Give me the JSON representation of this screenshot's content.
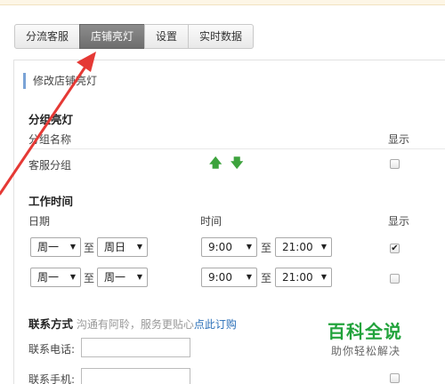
{
  "tabs": [
    {
      "label": "分流客服",
      "active": false
    },
    {
      "label": "店铺亮灯",
      "active": true
    },
    {
      "label": "设置",
      "active": false
    },
    {
      "label": "实时数据",
      "active": false
    }
  ],
  "panel": {
    "title": "修改店铺亮灯",
    "group_section": {
      "title": "分组亮灯",
      "col_name": "分组名称",
      "col_show": "显示",
      "rows": [
        {
          "name": "客服分组",
          "up_icon": "arrow-up-icon",
          "down_icon": "arrow-down-icon",
          "checked": false
        }
      ]
    },
    "work_section": {
      "title": "工作时间",
      "col_date": "日期",
      "col_time": "时间",
      "col_show": "显示",
      "to_label": "至",
      "rows": [
        {
          "day_from": "周一",
          "day_to": "周日",
          "time_from": "9:00",
          "time_to": "21:00",
          "checked": true
        },
        {
          "day_from": "周一",
          "day_to": "周一",
          "time_from": "9:00",
          "time_to": "21:00",
          "checked": false
        }
      ]
    },
    "contact_section": {
      "title": "联系方式",
      "hint": "沟通有阿聆，服务更贴心",
      "link": "点此订购",
      "phone_label": "联系电话:",
      "phone_value": "",
      "mobile_label": "联系手机:",
      "mobile_value": ""
    }
  },
  "watermark": {
    "brand": "百科全说",
    "tagline": "助你轻松解决"
  },
  "annotation": {
    "color": "#e53935"
  }
}
